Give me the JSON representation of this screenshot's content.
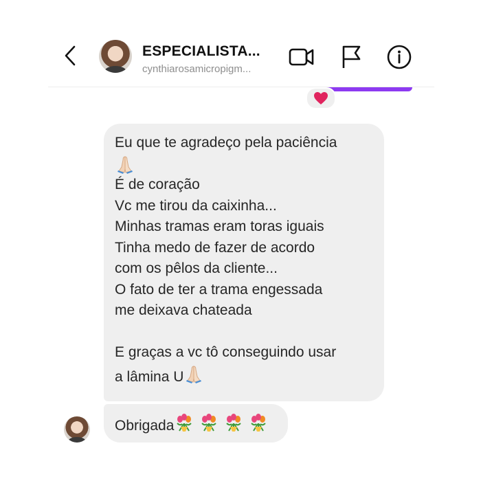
{
  "header": {
    "title": "ESPECIALISTA...",
    "subtitle": "cynthiarosamicropigm..."
  },
  "icons": {
    "back": "chevron-left-icon",
    "video": "video-camera-icon",
    "report": "flag-icon",
    "info": "info-icon",
    "reaction": "heart-icon",
    "pray": "folded-hands-icon",
    "flowers": "tulip-bouquet-icon"
  },
  "colors": {
    "sent_bubble": "#8d3af1",
    "received_bubble": "#efefef",
    "heart": "#e0245e"
  },
  "messages": [
    {
      "lines": [
        "Eu que te agradeço pela paciência",
        "",
        "É de coração",
        "Vc me tirou da caixinha...",
        "Minhas tramas eram toras iguais",
        "Tinha medo de fazer de acordo",
        "com os pêlos da cliente...",
        "O fato de ter a trama engessada",
        "me deixava chateada",
        "",
        "E graças a vc tô conseguindo usar",
        "a lâmina U"
      ]
    },
    {
      "text": "Obrigada"
    }
  ]
}
